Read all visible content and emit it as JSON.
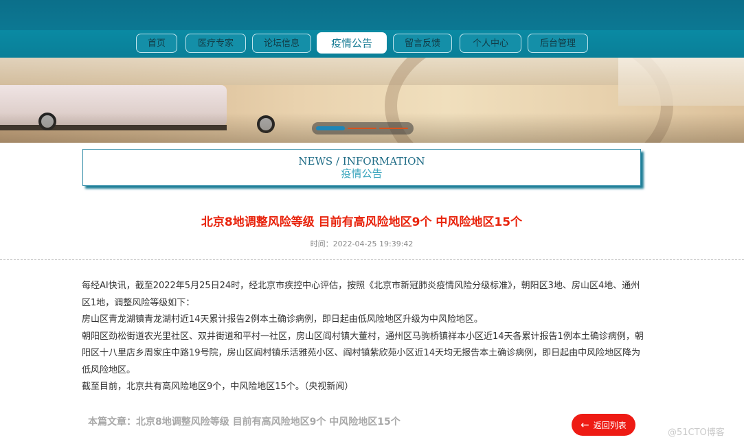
{
  "nav": {
    "items": [
      {
        "label": "首页"
      },
      {
        "label": "医疗专家"
      },
      {
        "label": "论坛信息"
      },
      {
        "label": "疫情公告"
      },
      {
        "label": "留言反馈"
      },
      {
        "label": "个人中心"
      },
      {
        "label": "后台管理"
      }
    ],
    "active_index": 3
  },
  "banner": {
    "slides_count": 3,
    "active_slide": 1
  },
  "section": {
    "title_en": "NEWS / INFORMATION",
    "title_cn": "疫情公告"
  },
  "article": {
    "title": "北京8地调整风险等级 目前有高风险地区9个 中风险地区15个",
    "time": "时间：2022-04-25 19:39:42",
    "paragraphs": [
      "每经AI快讯，截至2022年5月25日24时，经北京市疾控中心评估，按照《北京市新冠肺炎疫情风险分级标准》，朝阳区3地、房山区4地、通州区1地，调整风险等级如下：",
      "房山区青龙湖镇青龙湖村近14天累计报告2例本土确诊病例，即日起由低风险地区升级为中风险地区。",
      "朝阳区劲松街道农光里社区、双井街道和平村一社区，房山区阎村镇大董村，通州区马驹桥镇祥本小区近14天各累计报告1例本土确诊病例，朝阳区十八里店乡周家庄中路19号院，房山区阎村镇乐活雅苑小区、阎村镇紫欣苑小区近14天均无报告本土确诊病例，即日起由中风险地区降为低风险地区。",
      "截至目前，北京共有高风险地区9个，中风险地区15个。（央视新闻）"
    ],
    "footer_title": "本篇文章：北京8地调整风险等级 目前有高风险地区9个 中风险地区15个",
    "back_label": "返回列表",
    "back_arrow": "←"
  },
  "watermark": "@51CTO博客",
  "colors": {
    "header": "#0b6f8a",
    "nav": "#0a8aa3",
    "title_red": "#e8230c",
    "back_button": "#ee1b14"
  }
}
